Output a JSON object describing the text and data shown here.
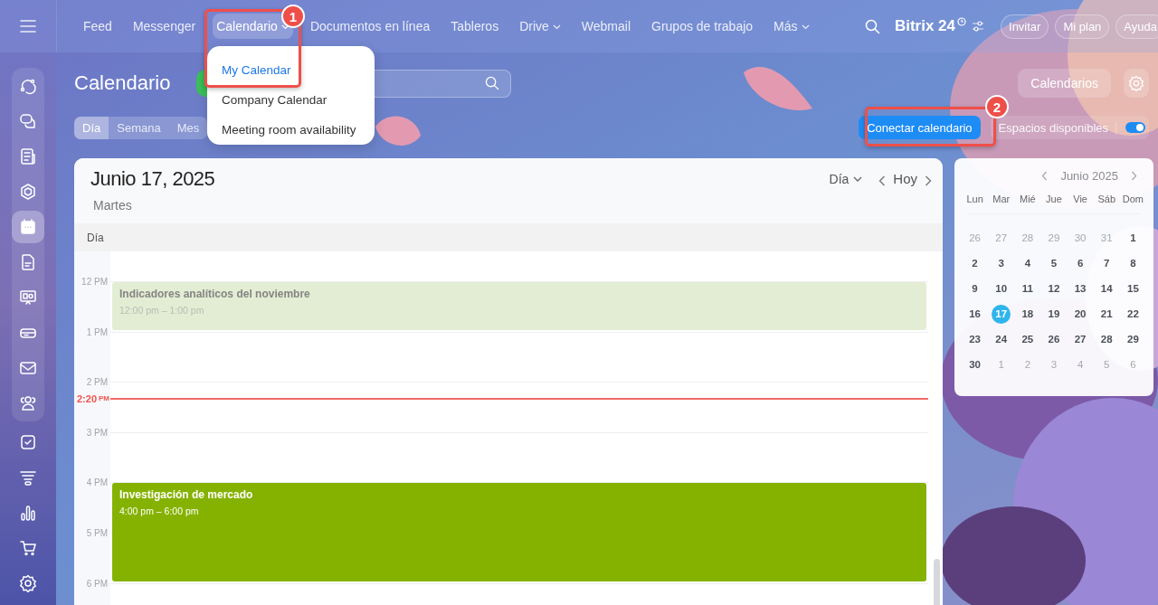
{
  "nav": {
    "items": [
      {
        "label": "Feed",
        "selected": false,
        "dropdown": false
      },
      {
        "label": "Messenger",
        "selected": false,
        "dropdown": false
      },
      {
        "label": "Calendario",
        "selected": true,
        "dropdown": true
      },
      {
        "label": "Documentos en línea",
        "selected": false,
        "dropdown": false
      },
      {
        "label": "Tableros",
        "selected": false,
        "dropdown": false
      },
      {
        "label": "Drive",
        "selected": false,
        "dropdown": true
      },
      {
        "label": "Webmail",
        "selected": false,
        "dropdown": false
      },
      {
        "label": "Grupos de trabajo",
        "selected": false,
        "dropdown": false
      },
      {
        "label": "Más",
        "selected": false,
        "dropdown": true
      }
    ],
    "logo": "Bitrix 24",
    "buttons": [
      "Invitar",
      "Mi plan",
      "Ayuda"
    ]
  },
  "nav_menu": {
    "items": [
      {
        "label": "My Calendar",
        "selected": true
      },
      {
        "label": "Company Calendar",
        "selected": false
      },
      {
        "label": "Meeting room availability",
        "selected": false
      }
    ]
  },
  "sidebar": {
    "items": [
      {
        "selected": false
      },
      {
        "selected": false
      },
      {
        "selected": false
      },
      {
        "selected": false
      },
      {
        "selected": true
      },
      {
        "selected": false
      },
      {
        "selected": false
      },
      {
        "selected": false
      },
      {
        "selected": false
      },
      {
        "selected": false
      },
      {
        "selected": false
      },
      {
        "selected": false
      },
      {
        "selected": false
      },
      {
        "selected": false
      },
      {
        "selected": false
      }
    ]
  },
  "page": {
    "title": "Calendario",
    "calendars_button": "Calendarios",
    "connect_button": "Conectar calendario",
    "free_slots": {
      "label": "Espacios disponibles",
      "on": true
    },
    "view_tabs": [
      {
        "label": "Día",
        "selected": true
      },
      {
        "label": "Semana",
        "selected": false
      },
      {
        "label": "Mes",
        "selected": false
      }
    ]
  },
  "day_view": {
    "date": "Junio 17, 2025",
    "weekday": "Martes",
    "view_select": "Día",
    "today_button": "Hoy",
    "column_header": "Día",
    "hours": [
      "12 PM",
      "1 PM",
      "2 PM",
      "3 PM",
      "4 PM",
      "5 PM",
      "6 PM"
    ],
    "now": {
      "time": "2:20",
      "suffix": "PM"
    },
    "events": [
      {
        "title": "Indicadores analíticos del noviembre",
        "time": "12:00 pm – 1:00 pm",
        "past": true
      },
      {
        "title": "Investigación de mercado",
        "time": "4:00 pm – 6:00 pm",
        "past": false
      }
    ]
  },
  "mini_calendar": {
    "month": "Junio 2025",
    "weekdays": [
      "Lun",
      "Mar",
      "Mié",
      "Jue",
      "Vie",
      "Sáb",
      "Dom"
    ],
    "weeks": [
      [
        {
          "day": "26",
          "muted": true,
          "selected": false
        },
        {
          "day": "27",
          "muted": true,
          "selected": false
        },
        {
          "day": "28",
          "muted": true,
          "selected": false
        },
        {
          "day": "29",
          "muted": true,
          "selected": false
        },
        {
          "day": "30",
          "muted": true,
          "selected": false
        },
        {
          "day": "31",
          "muted": true,
          "selected": false
        },
        {
          "day": "1",
          "muted": false,
          "selected": false
        }
      ],
      [
        {
          "day": "2",
          "muted": false,
          "selected": false
        },
        {
          "day": "3",
          "muted": false,
          "selected": false
        },
        {
          "day": "4",
          "muted": false,
          "selected": false
        },
        {
          "day": "5",
          "muted": false,
          "selected": false
        },
        {
          "day": "6",
          "muted": false,
          "selected": false
        },
        {
          "day": "7",
          "muted": false,
          "selected": false
        },
        {
          "day": "8",
          "muted": false,
          "selected": false
        }
      ],
      [
        {
          "day": "9",
          "muted": false,
          "selected": false
        },
        {
          "day": "10",
          "muted": false,
          "selected": false
        },
        {
          "day": "11",
          "muted": false,
          "selected": false
        },
        {
          "day": "12",
          "muted": false,
          "selected": false
        },
        {
          "day": "13",
          "muted": false,
          "selected": false
        },
        {
          "day": "14",
          "muted": false,
          "selected": false
        },
        {
          "day": "15",
          "muted": false,
          "selected": false
        }
      ],
      [
        {
          "day": "16",
          "muted": false,
          "selected": false
        },
        {
          "day": "17",
          "muted": false,
          "selected": true
        },
        {
          "day": "18",
          "muted": false,
          "selected": false
        },
        {
          "day": "19",
          "muted": false,
          "selected": false
        },
        {
          "day": "20",
          "muted": false,
          "selected": false
        },
        {
          "day": "21",
          "muted": false,
          "selected": false
        },
        {
          "day": "22",
          "muted": false,
          "selected": false
        }
      ],
      [
        {
          "day": "23",
          "muted": false,
          "selected": false
        },
        {
          "day": "24",
          "muted": false,
          "selected": false
        },
        {
          "day": "25",
          "muted": false,
          "selected": false
        },
        {
          "day": "26",
          "muted": false,
          "selected": false
        },
        {
          "day": "27",
          "muted": false,
          "selected": false
        },
        {
          "day": "28",
          "muted": false,
          "selected": false
        },
        {
          "day": "29",
          "muted": false,
          "selected": false
        }
      ],
      [
        {
          "day": "30",
          "muted": false,
          "selected": false
        },
        {
          "day": "1",
          "muted": true,
          "selected": false
        },
        {
          "day": "2",
          "muted": true,
          "selected": false
        },
        {
          "day": "3",
          "muted": true,
          "selected": false
        },
        {
          "day": "4",
          "muted": true,
          "selected": false
        },
        {
          "day": "5",
          "muted": true,
          "selected": false
        },
        {
          "day": "6",
          "muted": true,
          "selected": false
        }
      ]
    ]
  },
  "callouts": [
    "1",
    "2"
  ]
}
